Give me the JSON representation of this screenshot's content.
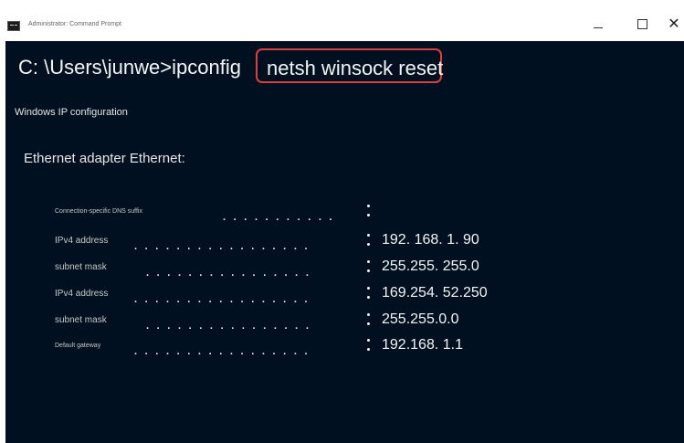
{
  "window": {
    "title": "Administrator: Command Prompt",
    "controls": {
      "minimize": "minimize",
      "maximize": "maximize",
      "close": "close"
    }
  },
  "terminal": {
    "prompt": "C: \\Users\\junwe>ipconfig",
    "highlighted_command": "netsh winsock reset",
    "highlight_color": "#d9403f",
    "background_color": "#001020",
    "ip_config_heading": "Windows IP configuration",
    "adapter_heading": "Ethernet adapter Ethernet:",
    "entries": [
      {
        "label": "Connection-specific DNS suffix",
        "value": ""
      },
      {
        "label": "IPv4 address",
        "value": "192. 168. 1. 90"
      },
      {
        "label": "subnet mask",
        "value": "255.255. 255.0"
      },
      {
        "label": "IPv4 address",
        "value": "169.254. 52.250"
      },
      {
        "label": "subnet mask",
        "value": "255.255.0.0"
      },
      {
        "label": "Default gateway",
        "value": "192.168. 1.1"
      }
    ]
  }
}
